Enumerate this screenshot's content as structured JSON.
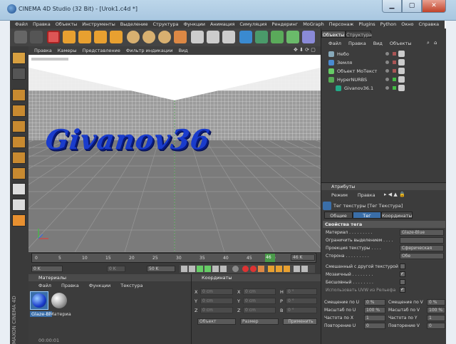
{
  "window": {
    "title": "CINEMA 4D Studio (32 Bit) - [Urok1.c4d *]",
    "close": "✕",
    "minimize": "▁",
    "maximize": "▢"
  },
  "menu": [
    "Файл",
    "Правка",
    "Объекты",
    "Инструменты",
    "Выделение",
    "Структура",
    "Функции",
    "Анимация",
    "Симуляция",
    "Рендеринг",
    "MoGraph",
    "Персонаж",
    "Plugins",
    "Python",
    "Окно",
    "Справка"
  ],
  "viewport": {
    "menu": [
      "Правка",
      "Камеры",
      "Представление",
      "Фильтр индикации",
      "Вид"
    ],
    "text3d": "Givanov36",
    "controls": "✥ ⬇ ⟳ ▢"
  },
  "timeline": {
    "ticks": [
      "0",
      "5",
      "10",
      "15",
      "20",
      "25",
      "30",
      "35",
      "40",
      "45",
      "50"
    ],
    "current_frame": "46",
    "end_field": "46 K",
    "start_field": "0 K",
    "range_field": "50 K",
    "mid_field": "0 K"
  },
  "materials": {
    "title": "Материалы",
    "menu": [
      "Файл",
      "Правка",
      "Функции",
      "Текстура"
    ],
    "items": [
      {
        "name": "Glaze-Bl"
      },
      {
        "name": "Материа"
      }
    ]
  },
  "coords": {
    "title": "Координаты",
    "rows": [
      {
        "a": "X",
        "av": "0 cm",
        "b": "X",
        "bv": "0 cm",
        "c": "H",
        "cv": "0 °"
      },
      {
        "a": "Y",
        "av": "0 cm",
        "b": "Y",
        "bv": "0 cm",
        "c": "P",
        "cv": "0 °"
      },
      {
        "a": "Z",
        "av": "0 cm",
        "b": "Z",
        "bv": "0 cm",
        "c": "B",
        "cv": "0 °"
      }
    ],
    "dropdown1": "Объект",
    "dropdown2": "Размер",
    "apply": "Применить"
  },
  "objects": {
    "tabs": [
      "Объекты",
      "Структура"
    ],
    "menu": [
      "Файл",
      "Правка",
      "Вид",
      "Объекты"
    ],
    "items": [
      {
        "name": "Небо",
        "indent": 0
      },
      {
        "name": "Земля",
        "indent": 0
      },
      {
        "name": "Объект МоТекст",
        "indent": 0
      },
      {
        "name": "HyperNURBS",
        "indent": 0
      },
      {
        "name": "Givanov36.1",
        "indent": 1
      }
    ]
  },
  "attributes": {
    "title": "Атрибуты",
    "menu": [
      "Режим",
      "Правка"
    ],
    "tag_title": "Тег текстуры [Тег Текстура]",
    "tabs": [
      "Общие",
      "Тег",
      "Координаты"
    ],
    "section": "Свойства тега",
    "props": [
      {
        "label": "Материал . . . . . . . . .",
        "value": "Glaze-Blue"
      },
      {
        "label": "Ограничить выделением . . . .",
        "value": ""
      },
      {
        "label": "Проекция текстуры . . . .",
        "value": "Сферическая"
      },
      {
        "label": "Сторона . . . . . . . . .",
        "value": "Обе"
      }
    ],
    "checks": [
      {
        "label": "Смешанный с другой текстурой",
        "checked": false
      },
      {
        "label": "Мозаичный . . . . . . . .",
        "checked": true
      },
      {
        "label": "Бесшовный . . . . . . . .",
        "checked": false
      },
      {
        "label": "Использовать UVW из Рельефа",
        "checked": true
      }
    ],
    "pairs": [
      {
        "l": "Смещение по U",
        "lv": "0 %",
        "r": "Смещение по V",
        "rv": "0 %"
      },
      {
        "l": "Масштаб по U",
        "lv": "100 %",
        "r": "Масштаб по V",
        "rv": "100 %"
      },
      {
        "l": "Частота по X",
        "lv": "1",
        "r": "Частота по Y",
        "rv": "1"
      },
      {
        "l": "Повторение U",
        "lv": "0",
        "r": "Повторение V",
        "rv": "0"
      }
    ]
  },
  "status": {
    "time": "00:00:01"
  },
  "brand": "MAXON CINEMA 4D",
  "colors": {
    "accent": "#3a6ea8",
    "text_blue": "#1a3ccc",
    "panel": "#3c3c3c"
  }
}
